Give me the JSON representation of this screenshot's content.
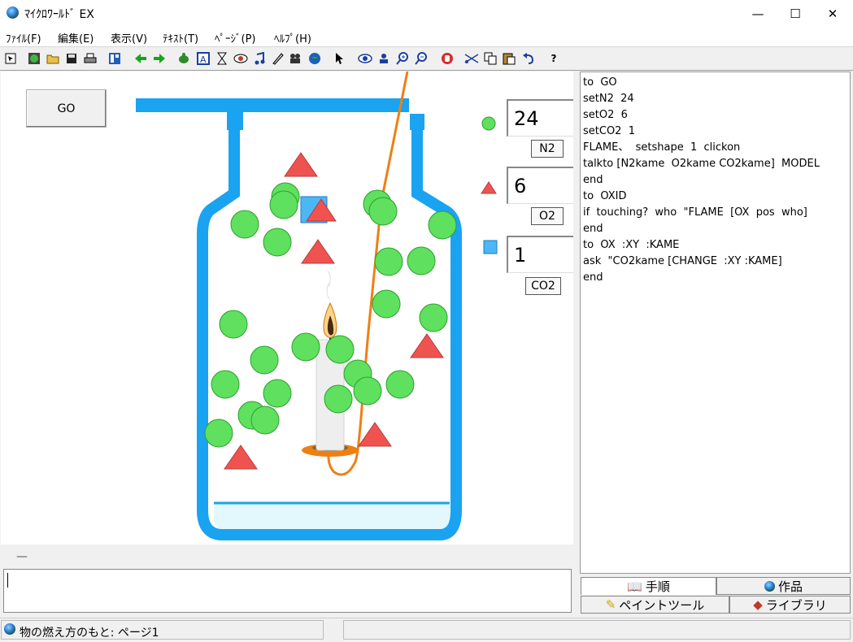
{
  "window": {
    "title": "ﾏｲｸﾛﾜｰﾙﾄﾞ EX",
    "minimize": "—",
    "maximize": "☐",
    "close": "✕"
  },
  "menu": [
    "ﾌｧｲﾙ(F)",
    "編集(E)",
    "表示(V)",
    "ﾃｷｽﾄ(T)",
    "ﾍﾟｰｼﾞ(P)",
    "ﾍﾙﾌﾟ(H)"
  ],
  "toolbar": {
    "icons": [
      "pointer-select-icon",
      "world-icon",
      "open-folder-icon",
      "save-disk-icon",
      "print-icon",
      "layout-icon",
      "arrow-left-icon",
      "arrow-right-icon",
      "turtle-icon",
      "text-a-icon",
      "hourglass-icon",
      "eye-shape-icon",
      "music-note-icon",
      "pen-icon",
      "camera-icon",
      "globe-icon",
      "cursor-arrow-icon",
      "eye-icon",
      "stamp-icon",
      "zoom-in-icon",
      "zoom-out-icon",
      "stop-hand-icon",
      "cut-icon",
      "copy-icon",
      "paste-icon",
      "undo-icon",
      "help-icon"
    ],
    "help_label": "?"
  },
  "canvas": {
    "go_label": "GO",
    "counters": [
      {
        "value": "24",
        "label": "N2",
        "shape": "circle",
        "color": "#5fe05f"
      },
      {
        "value": "6",
        "label": "O2",
        "shape": "triangle",
        "color": "#ef5350"
      },
      {
        "value": "1",
        "label": "CO2",
        "shape": "square",
        "color": "#4db6f5"
      }
    ],
    "colors": {
      "jar": "#1aa3f0",
      "n2": "#5fe05f",
      "o2": "#ef5350",
      "co2": "#4db6f5",
      "wire": "#ef7f13"
    }
  },
  "code_panel": {
    "text": "to  GO\nsetN2  24\nsetO2  6\nsetCO2  1\nFLAME、  setshape  1  clickon\ntalkto [N2kame  O2kame CO2kame]  MODEL\nend\nto  OXID\nif  touching?  who  \"FLAME  [OX  pos  who]\nend\nto  OX  :XY  :KAME\nask  \"CO2kame [CHANGE  :XY :KAME]\nend"
  },
  "status_area": {
    "dash": "—"
  },
  "tabs": {
    "procedure": "手順",
    "works": "作品",
    "paint_tool": "ペイントツール",
    "library": "ライブラリ"
  },
  "statusbar": {
    "text": "物の燃え方のもと: ページ1"
  }
}
